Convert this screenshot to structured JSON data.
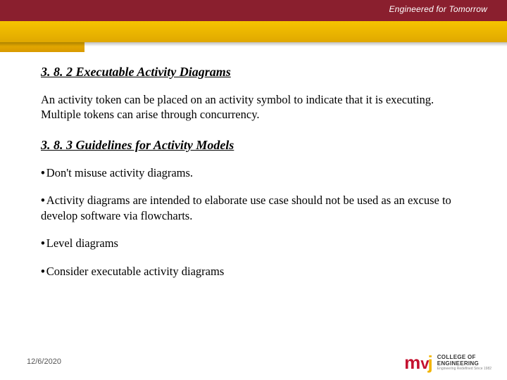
{
  "header": {
    "tagline": "Engineered for Tomorrow"
  },
  "content": {
    "heading1": "3. 8. 2 Executable Activity Diagrams",
    "paragraph1": "An activity token can be placed on an activity symbol to indicate that it is executing. Multiple tokens can arise through concurrency.",
    "heading2": "3. 8. 3 Guidelines for Activity Models",
    "bullets": [
      "Don't misuse activity diagrams.",
      "Activity diagrams are intended to elaborate use case should not be used as an excuse to develop software via flowcharts.",
      "Level diagrams",
      "Consider executable activity diagrams"
    ]
  },
  "footer": {
    "date": "12/6/2020",
    "logo": {
      "mark_m": "m",
      "mark_v": "v",
      "mark_j": "j",
      "text1": "COLLEGE OF",
      "text2": "ENGINEERING",
      "text3": "Engineering Redefined Since 1982"
    }
  }
}
